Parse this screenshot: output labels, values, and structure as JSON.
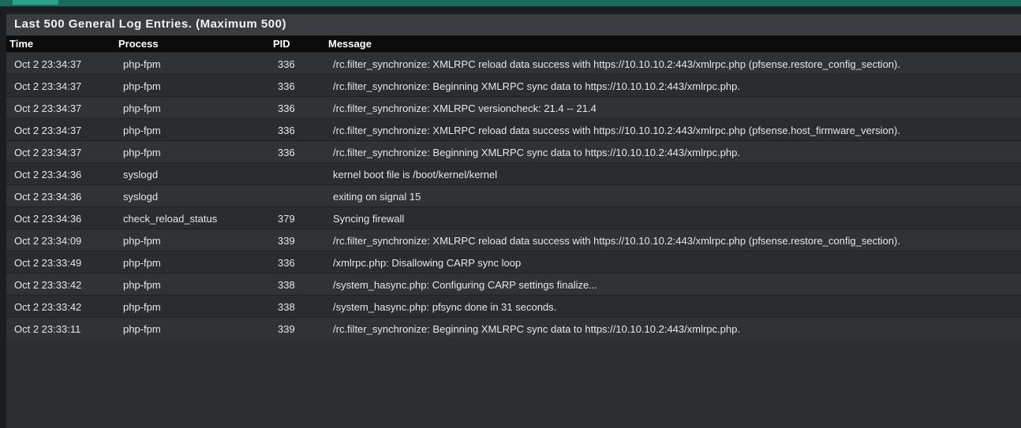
{
  "panel": {
    "title": "Last 500 General Log Entries. (Maximum 500)"
  },
  "columns": {
    "time": "Time",
    "process": "Process",
    "pid": "PID",
    "message": "Message"
  },
  "rows": [
    {
      "time": "Oct 2 23:34:37",
      "process": "php-fpm",
      "pid": "336",
      "message": "/rc.filter_synchronize: XMLRPC reload data success with https://10.10.10.2:443/xmlrpc.php (pfsense.restore_config_section)."
    },
    {
      "time": "Oct 2 23:34:37",
      "process": "php-fpm",
      "pid": "336",
      "message": "/rc.filter_synchronize: Beginning XMLRPC sync data to https://10.10.10.2:443/xmlrpc.php."
    },
    {
      "time": "Oct 2 23:34:37",
      "process": "php-fpm",
      "pid": "336",
      "message": "/rc.filter_synchronize: XMLRPC versioncheck: 21.4 -- 21.4"
    },
    {
      "time": "Oct 2 23:34:37",
      "process": "php-fpm",
      "pid": "336",
      "message": "/rc.filter_synchronize: XMLRPC reload data success with https://10.10.10.2:443/xmlrpc.php (pfsense.host_firmware_version)."
    },
    {
      "time": "Oct 2 23:34:37",
      "process": "php-fpm",
      "pid": "336",
      "message": "/rc.filter_synchronize: Beginning XMLRPC sync data to https://10.10.10.2:443/xmlrpc.php."
    },
    {
      "time": "Oct 2 23:34:36",
      "process": "syslogd",
      "pid": "",
      "message": "kernel boot file is /boot/kernel/kernel"
    },
    {
      "time": "Oct 2 23:34:36",
      "process": "syslogd",
      "pid": "",
      "message": "exiting on signal 15"
    },
    {
      "time": "Oct 2 23:34:36",
      "process": "check_reload_status",
      "pid": "379",
      "message": "Syncing firewall"
    },
    {
      "time": "Oct 2 23:34:09",
      "process": "php-fpm",
      "pid": "339",
      "message": "/rc.filter_synchronize: XMLRPC reload data success with https://10.10.10.2:443/xmlrpc.php (pfsense.restore_config_section)."
    },
    {
      "time": "Oct 2 23:33:49",
      "process": "php-fpm",
      "pid": "336",
      "message": "/xmlrpc.php: Disallowing CARP sync loop"
    },
    {
      "time": "Oct 2 23:33:42",
      "process": "php-fpm",
      "pid": "338",
      "message": "/system_hasync.php: Configuring CARP settings finalize..."
    },
    {
      "time": "Oct 2 23:33:42",
      "process": "php-fpm",
      "pid": "338",
      "message": "/system_hasync.php: pfsync done in 31 seconds."
    },
    {
      "time": "Oct 2 23:33:11",
      "process": "php-fpm",
      "pid": "339",
      "message": "/rc.filter_synchronize: Beginning XMLRPC sync data to https://10.10.10.2:443/xmlrpc.php."
    }
  ]
}
